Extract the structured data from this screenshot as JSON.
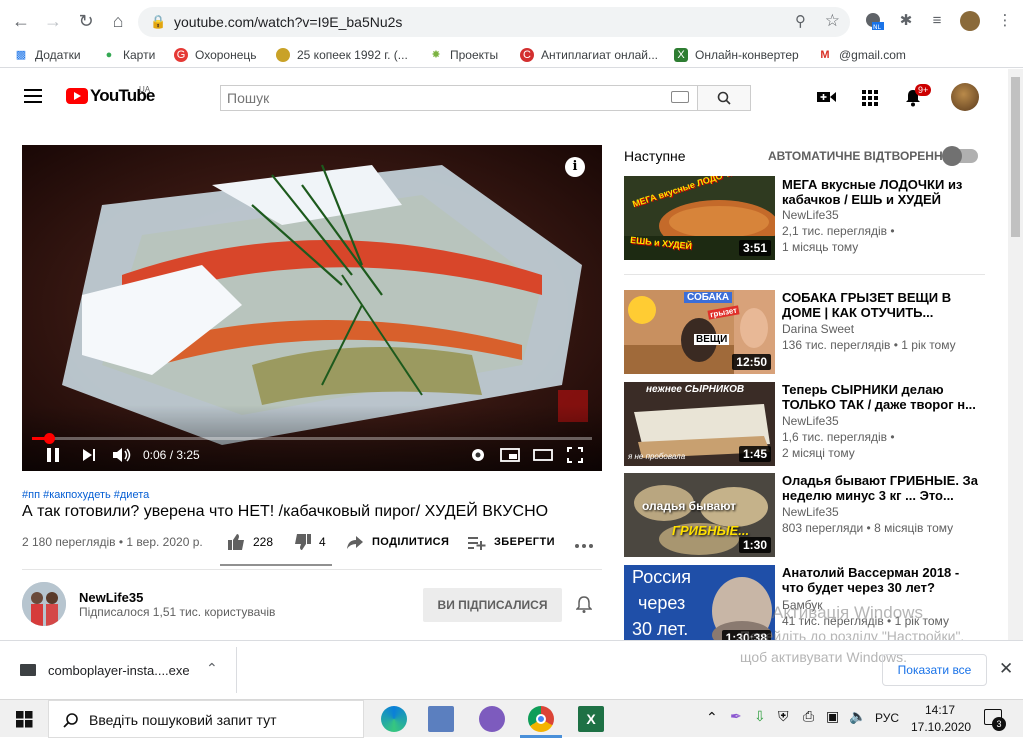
{
  "browser": {
    "url": "youtube.com/watch?v=I9E_ba5Nu2s",
    "bookmarks": [
      "Додатки",
      "Карти",
      "Охоронець",
      "25 копеек 1992 г. (...",
      "Проекты",
      "Антиплагиат онлай...",
      "Онлайн-конвертер",
      "@gmail.com"
    ]
  },
  "yt": {
    "logo_text": "YouTube",
    "region": "UA",
    "search_placeholder": "Пошук",
    "notif_count": "9+"
  },
  "video": {
    "time": "0:06 / 3:25",
    "progress": 0.03,
    "hashtags": "#пп #какпохудеть #диета",
    "title": "А так готовили? уверена что НЕТ! /кабачковый пирог/ ХУДЕЙ ВКУСНО",
    "views_date": "2 180 переглядів • 1 вер. 2020 р.",
    "likes": "228",
    "dislikes": "4",
    "share": "ПОДІЛИТИСЯ",
    "save": "ЗБЕРЕГТИ"
  },
  "channel": {
    "name": "NewLife35",
    "subs": "Підписалося 1,51 тис. користувачів",
    "subscribe_label": "ВИ ПІДПИСАЛИСЯ"
  },
  "sidebar": {
    "next_label": "Наступне",
    "autoplay_label": "АВТОМАТИЧНЕ ВІДТВОРЕННЯ",
    "items": [
      {
        "title": "МЕГА вкусные ЛОДОЧКИ из кабачков / ЕШЬ и ХУДЕЙ",
        "channel": "NewLife35",
        "views": "2,1 тис. переглядів •",
        "age": "1 місяць тому",
        "duration": "3:51"
      },
      {
        "title": "СОБАКА ГРЫЗЕТ ВЕЩИ В ДОМЕ | КАК ОТУЧИТЬ...",
        "channel": "Darina Sweet",
        "views": "136 тис. переглядів • 1 рік тому",
        "age": "",
        "duration": "12:50"
      },
      {
        "title": "Теперь СЫРНИКИ делаю ТОЛЬКО ТАК / даже творог н...",
        "channel": "NewLife35",
        "views": "1,6 тис. переглядів •",
        "age": "2 місяці тому",
        "duration": "1:45"
      },
      {
        "title": "Оладья бывают ГРИБНЫЕ. За неделю минус 3 кг ... Это...",
        "channel": "NewLife35",
        "views": "803 перегляди • 8 місяців тому",
        "age": "",
        "duration": "1:30"
      },
      {
        "title": "Анатолий Вассерман 2018 - что будет через 30 лет?",
        "channel": "Бамбук",
        "views": "41 тис. переглядів • 1 рік тому",
        "age": "",
        "duration": "1:30:38"
      }
    ],
    "thumb_text": {
      "t1_a": "МЕГА вкусные ЛОДОЧКИ",
      "t1_b": "ЕШЬ и ХУДЕЙ",
      "t2_a": "СОБАКА",
      "t2_b": "грызет",
      "t2_c": "ВЕЩИ",
      "t3_a": "нежнее СЫРНИКОВ",
      "t3_b": "я не пробовала",
      "t4_a": "оладья бывают",
      "t4_b": "ГРИБНЫЕ...",
      "t5_a": "Россия",
      "t5_b": "через",
      "t5_c": "30 лет."
    }
  },
  "watermark": {
    "line1": "Активація Windows",
    "line2": "Перейдіть до розділу \"Настройки\",",
    "line3": "щоб активувати Windows."
  },
  "download": {
    "file": "comboplayer-insta....exe",
    "show_all": "Показати все"
  },
  "taskbar": {
    "search_placeholder": "Введіть пошуковий запит тут",
    "lang": "РУС",
    "time": "14:17",
    "date": "17.10.2020",
    "notif": "3"
  }
}
